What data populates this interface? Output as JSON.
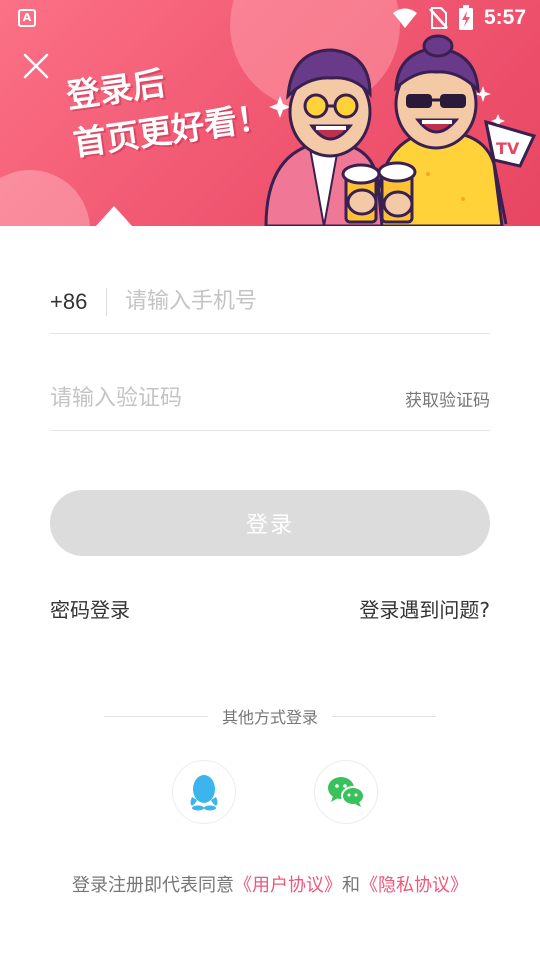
{
  "status_bar": {
    "time": "5:57",
    "app_icon_letter": "A",
    "icons": [
      "wifi-icon",
      "no-sim-icon",
      "battery-charging-icon"
    ]
  },
  "banner": {
    "promo_line1": "登录后",
    "promo_line2": "首页更好看！",
    "flag_text": "TV",
    "colors": {
      "gradient_start": "#fb7186",
      "gradient_end": "#e84663"
    }
  },
  "form": {
    "country_code": "+86",
    "phone_placeholder": "请输入手机号",
    "phone_value": "",
    "code_placeholder": "请输入验证码",
    "code_value": "",
    "get_code_label": "获取验证码",
    "login_label": "登录",
    "login_button_color": "#dcdcdc"
  },
  "links": {
    "password_login": "密码登录",
    "login_problem": "登录遇到问题?"
  },
  "other_login": {
    "label": "其他方式登录",
    "methods": [
      {
        "icon": "qq-icon",
        "color": "#3cb5ef"
      },
      {
        "icon": "wechat-icon",
        "color": "#39c15b"
      }
    ]
  },
  "agreement": {
    "prefix": "登录注册即代表同意",
    "user_agreement": "《用户协议》",
    "conjunction": "和",
    "privacy_agreement": "《隐私协议》",
    "link_color": "#f0577a"
  }
}
